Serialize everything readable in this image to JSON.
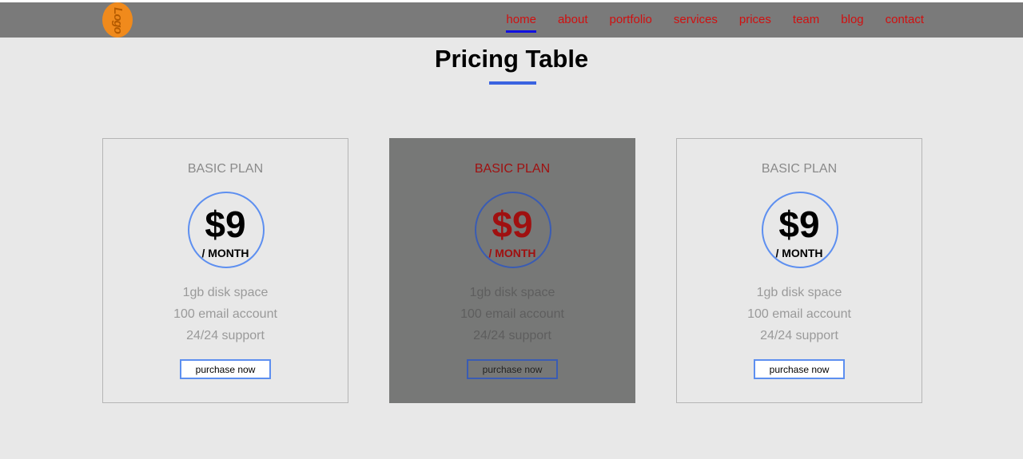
{
  "header": {
    "logo_text": "Logo",
    "nav": [
      {
        "label": "home",
        "active": true
      },
      {
        "label": "about"
      },
      {
        "label": "portfolio"
      },
      {
        "label": "services"
      },
      {
        "label": "prices"
      },
      {
        "label": "team"
      },
      {
        "label": "blog"
      },
      {
        "label": "contact"
      }
    ]
  },
  "main": {
    "title": "Pricing Table",
    "cards": [
      {
        "plan": "BASIC PLAN",
        "price": "$9",
        "period": "/ MONTH",
        "features": [
          "1gb disk space",
          "100 email account",
          "24/24 support"
        ],
        "button": "purchase now"
      },
      {
        "plan": "BASIC PLAN",
        "price": "$9",
        "period": "/ MONTH",
        "features": [
          "1gb disk space",
          "100 email account",
          "24/24 support"
        ],
        "button": "purchase now"
      },
      {
        "plan": "BASIC PLAN",
        "price": "$9",
        "period": "/ MONTH",
        "features": [
          "1gb disk space",
          "100 email account",
          "24/24 support"
        ],
        "button": "purchase now"
      }
    ]
  },
  "colors": {
    "nav_bg": "#7a7a7a",
    "nav_link": "#d01010",
    "accent": "#3a63e0",
    "logo": "#f08a1c",
    "highlight_card": "#777877"
  }
}
